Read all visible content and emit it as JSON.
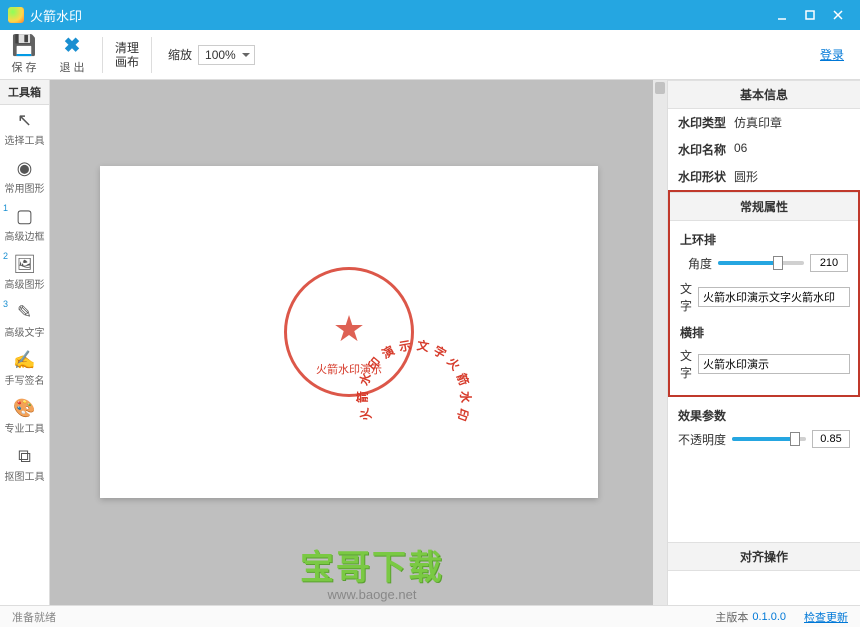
{
  "window": {
    "title": "火箭水印"
  },
  "toolbar": {
    "save": "保 存",
    "exit": "退 出",
    "clear_line1": "清理",
    "clear_line2": "画布",
    "zoom_label": "缩放",
    "zoom_value": "100%",
    "login": "登录"
  },
  "toolbox": {
    "header": "工具箱",
    "tools": [
      {
        "icon": "cursor",
        "label": "选择工具"
      },
      {
        "icon": "circle",
        "label": "常用图形"
      },
      {
        "icon": "square",
        "label": "高级边框",
        "num": "1"
      },
      {
        "icon": "image",
        "label": "高级图形",
        "num": "2"
      },
      {
        "icon": "text",
        "label": "高级文字",
        "num": "3"
      },
      {
        "icon": "pen",
        "label": "手写签名"
      },
      {
        "icon": "palette",
        "label": "专业工具"
      },
      {
        "icon": "crop",
        "label": "抠图工具"
      }
    ]
  },
  "stamp": {
    "arc_text": "火箭水印演示文字火箭水印",
    "bottom_text": "火箭水印演示"
  },
  "basic": {
    "header": "基本信息",
    "type_k": "水印类型",
    "type_v": "仿真印章",
    "name_k": "水印名称",
    "name_v": "06",
    "shape_k": "水印形状",
    "shape_v": "圆形"
  },
  "props": {
    "header": "常规属性",
    "upper": "上环排",
    "angle_label": "角度",
    "angle_value": "210",
    "angle_pct": 70,
    "text_label": "文字",
    "upper_text": "火箭水印演示文字火箭水印",
    "horiz": "横排",
    "horiz_text": "火箭水印演示"
  },
  "effect": {
    "header": "效果参数",
    "opacity_label": "不透明度",
    "opacity_value": "0.85",
    "opacity_pct": 85
  },
  "align": {
    "header": "对齐操作"
  },
  "status": {
    "ready": "准备就绪",
    "version_label": "主版本",
    "version": "0.1.0.0",
    "check_update": "检查更新"
  },
  "overlay": {
    "text": "宝哥下载",
    "url": "www.baoge.net"
  }
}
